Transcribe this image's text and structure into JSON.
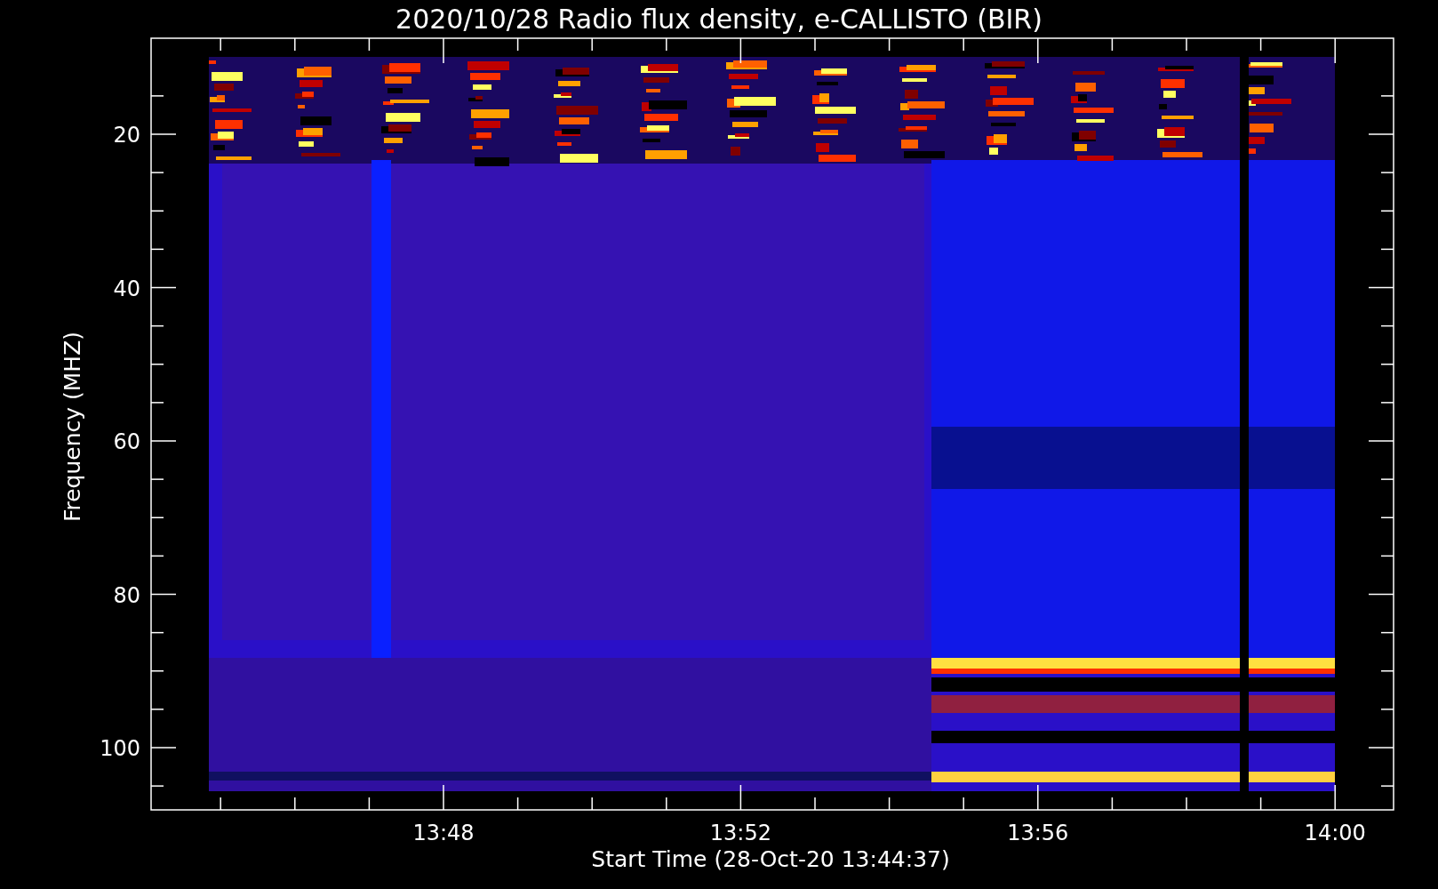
{
  "plot": {
    "title": "2020/10/28  Radio flux density, e-CALLISTO (BIR)",
    "ylabel": "Frequency (MHZ)",
    "xlabel": "Start Time (28-Oct-20 13:44:37)",
    "yticks": [
      "20",
      "40",
      "60",
      "80",
      "100"
    ],
    "xticks": [
      "13:48",
      "13:52",
      "13:56",
      "14:00"
    ]
  }
}
